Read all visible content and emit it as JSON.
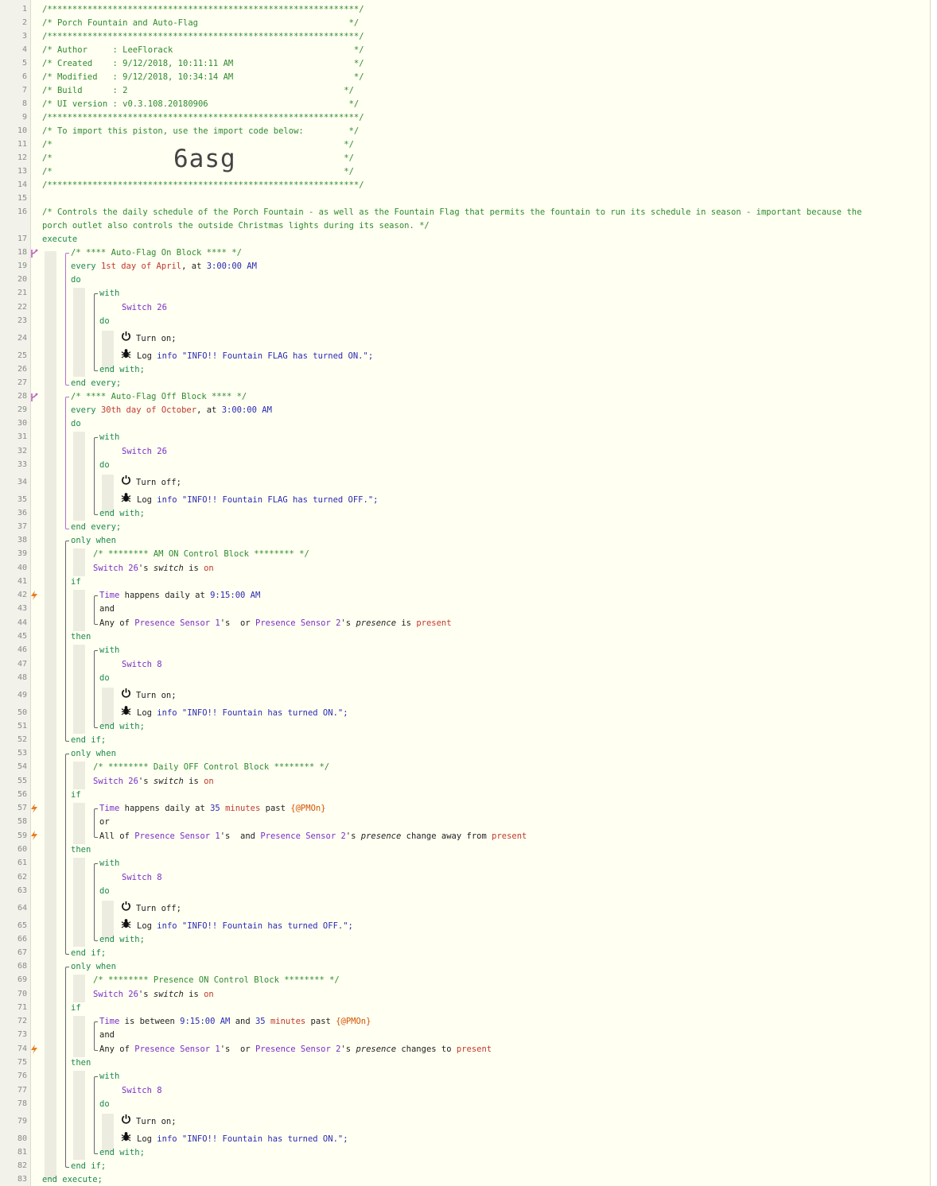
{
  "gutter": {
    "line_numbers": [
      "1",
      "2",
      "3",
      "4",
      "5",
      "6",
      "7",
      "8",
      "9",
      "10",
      "11",
      "12",
      "13",
      "14",
      "15",
      "16",
      "17",
      "18",
      "19",
      "20",
      "21",
      "22",
      "23",
      "24",
      "25",
      "26",
      "27",
      "28",
      "29",
      "30",
      "31",
      "32",
      "33",
      "34",
      "35",
      "36",
      "37",
      "38",
      "39",
      "40",
      "41",
      "42",
      "43",
      "44",
      "45",
      "46",
      "47",
      "48",
      "49",
      "50",
      "51",
      "52",
      "53",
      "54",
      "55",
      "56",
      "57",
      "58",
      "59",
      "60",
      "61",
      "62",
      "63",
      "64",
      "65",
      "66",
      "67",
      "68",
      "69",
      "70",
      "71",
      "72",
      "73",
      "74",
      "75",
      "76",
      "77",
      "78",
      "79",
      "80",
      "81",
      "82",
      "83"
    ]
  },
  "header": {
    "border": "/**************************************************************/",
    "title": "/* Porch Fountain and Auto-Flag                              */",
    "author": "/* Author     : LeeFlorack                                    */",
    "created": "/* Created    : 9/12/2018, 10:11:11 AM                        */",
    "modified": "/* Modified   : 9/12/2018, 10:34:14 AM                        */",
    "build": "/* Build      : 2                                           */",
    "ui_version": "/* UI version : v0.3.108.20180906                            */",
    "import_text": "/* To import this piston, use the import code below:         */",
    "blank_comment": "/*                                                          */",
    "import_code": "6asg"
  },
  "description": {
    "line1": "/* Controls the daily schedule of the Porch Fountain - as well as the Fountain Flag that permits the fountain to run its schedule in season - important because the",
    "line2": "porch outlet also controls the outside Christmas lights during its season. */"
  },
  "kw": {
    "execute": "execute",
    "end_execute": "end execute;",
    "every": "every",
    "do": "do",
    "with": "with",
    "end_with": "end with;",
    "end_every": "end every;",
    "only_when": "only when",
    "if": "if",
    "then": "then",
    "end_if": "end if;",
    "and": "and",
    "or": "or",
    "of": " of ",
    "day": " day",
    "at": ", at ",
    "s": "'s ",
    "is": " is ",
    "switch": "switch",
    "presence": "presence",
    "turn_on": "Turn on;",
    "turn_off": "Turn off;",
    "log": "Log ",
    "info": "info",
    "time": "Time",
    "happens_daily_at": " happens daily at ",
    "is_between": " is between ",
    "and_mid": " and ",
    "or_mid": " or ",
    "past": " past ",
    "any_of": "Any of ",
    "all_of": "All of ",
    "change_away_from": " change away from ",
    "changes_to": " changes to ",
    "on": "on",
    "present": "present",
    "minutes": "minutes",
    "pmon": "{@PMOn}"
  },
  "block1": {
    "comment": "/* **** Auto-Flag On Block **** */",
    "ordinal": "1st",
    "month": "April",
    "time": "3:00:00 AM",
    "device": "Switch 26",
    "log_msg": "\"INFO!! Fountain FLAG has turned ON.\";"
  },
  "block2": {
    "comment": "/* **** Auto-Flag Off Block **** */",
    "ordinal": "30th",
    "month": "October",
    "time": "3:00:00 AM",
    "device": "Switch 26",
    "log_msg": "\"INFO!! Fountain FLAG has turned OFF.\";"
  },
  "block3": {
    "comment": "/* ******** AM ON Control Block ******** */",
    "cond_device": "Switch 26",
    "time": "9:15:00 AM",
    "sensor1": "Presence Sensor 1",
    "sensor2": "Presence Sensor 2",
    "device": "Switch 8",
    "log_msg": "\"INFO!! Fountain has turned ON.\";"
  },
  "block4": {
    "comment": "/* ******** Daily OFF Control Block ******** */",
    "cond_device": "Switch 26",
    "minutes_value": "35",
    "sensor1": "Presence Sensor 1",
    "sensor2": "Presence Sensor 2",
    "device": "Switch 8",
    "log_msg": "\"INFO!! Fountain has turned OFF.\";"
  },
  "block5": {
    "comment": "/* ******** Presence ON Control Block ******** */",
    "cond_device": "Switch 26",
    "time": "9:15:00 AM",
    "minutes_value": "35",
    "sensor1": "Presence Sensor 1",
    "sensor2": "Presence Sensor 2",
    "device": "Switch 8",
    "log_msg": "\"INFO!! Fountain has turned ON.\";"
  },
  "colors": {
    "comment": "#2e8b2e",
    "keyword": "#1a8a4a",
    "value": "#2a2ab5",
    "device": "#7b2fc9",
    "literal": "#c0392b",
    "variable": "#d35400",
    "background": "#fffff2"
  }
}
